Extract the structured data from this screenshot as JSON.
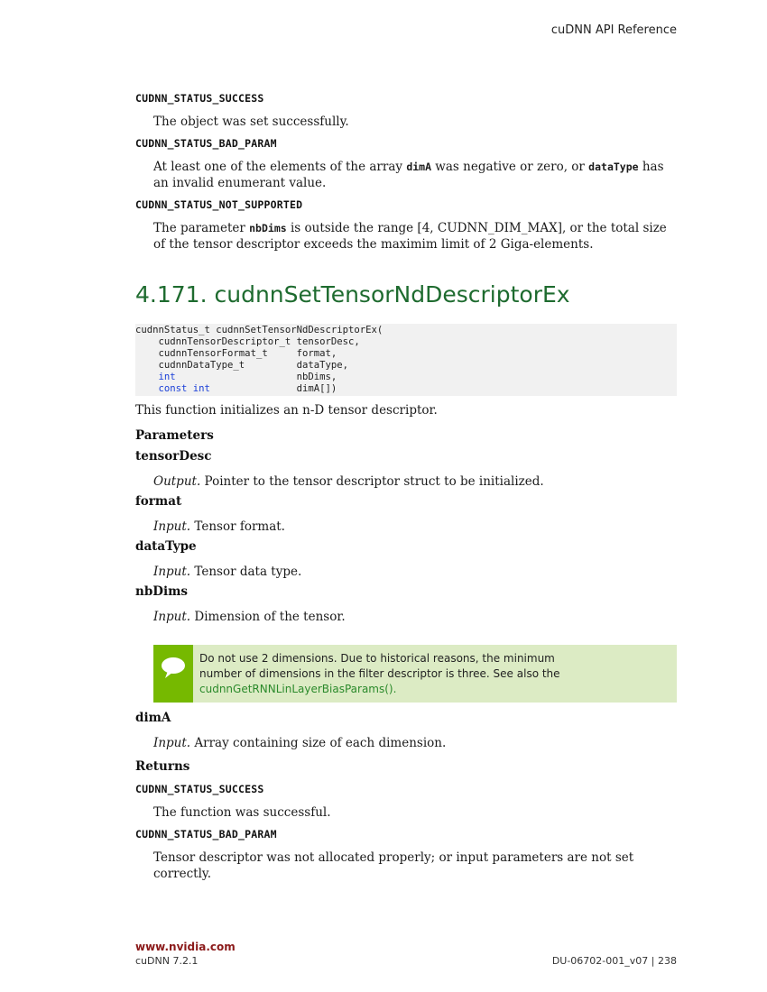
{
  "header": {
    "title": "cuDNN API Reference"
  },
  "top_returns": [
    {
      "constant": "CUDNN_STATUS_SUCCESS",
      "desc": "The object was set successfully."
    },
    {
      "constant": "CUDNN_STATUS_BAD_PARAM",
      "desc_parts": [
        "At least one of the elements of the array ",
        "dimA",
        " was negative or zero, or ",
        "dataType",
        " has an invalid enumerant value."
      ]
    },
    {
      "constant": "CUDNN_STATUS_NOT_SUPPORTED",
      "desc_parts": [
        "The parameter ",
        "nbDims",
        " is outside the range [4, CUDNN_DIM_MAX], or the total size of the tensor descriptor exceeds the maximim limit of 2 Giga-elements."
      ]
    }
  ],
  "section": {
    "number": "4.171.",
    "title": "cudnnSetTensorNdDescriptorEx"
  },
  "code": {
    "signature": "cudnnStatus_t cudnnSetTensorNdDescriptorEx(",
    "params": [
      {
        "kw": "",
        "type": "cudnnTensorDescriptor_t",
        "pad": " ",
        "name": "tensorDesc,"
      },
      {
        "kw": "",
        "type": "cudnnTensorFormat_t",
        "pad": "     ",
        "name": "format,"
      },
      {
        "kw": "",
        "type": "cudnnDataType_t",
        "pad": "         ",
        "name": "dataType,"
      },
      {
        "kw": "int",
        "type": "",
        "pad": "                     ",
        "name": "nbDims,"
      },
      {
        "kw": "const int",
        "type": "",
        "pad": "               ",
        "name": "dimA[])"
      }
    ]
  },
  "intro": "This function initializes an n-D tensor descriptor.",
  "parameters_heading": "Parameters",
  "parameters": [
    {
      "name": "tensorDesc",
      "io": "Output.",
      "desc": " Pointer to the tensor descriptor struct to be initialized."
    },
    {
      "name": "format",
      "io": "Input.",
      "desc": " Tensor format."
    },
    {
      "name": "dataType",
      "io": "Input.",
      "desc": " Tensor data type."
    },
    {
      "name": "nbDims",
      "io": "Input.",
      "desc": " Dimension of the tensor."
    }
  ],
  "note": {
    "icon": "speech-bubble-icon",
    "line1": "Do not use 2 dimensions. Due to historical reasons, the minimum",
    "line2": "number of dimensions in the filter descriptor is three. See also the",
    "link": "cudnnGetRNNLinLayerBiasParams()",
    "after_link": ".",
    "accent": "#76b900",
    "background": "#dcebc4"
  },
  "param_dimA": {
    "name": "dimA",
    "io": "Input.",
    "desc": " Array containing size of each dimension."
  },
  "returns_heading": "Returns",
  "returns": [
    {
      "constant": "CUDNN_STATUS_SUCCESS",
      "desc": "The function was successful."
    },
    {
      "constant": "CUDNN_STATUS_BAD_PARAM",
      "desc": "Tensor descriptor was not allocated properly; or input parameters are not set correctly."
    }
  ],
  "footer": {
    "site": "www.nvidia.com",
    "product": "cuDNN 7.2.1",
    "doc_id": "DU-06702-001_v07",
    "separator": "|",
    "page": "238"
  }
}
